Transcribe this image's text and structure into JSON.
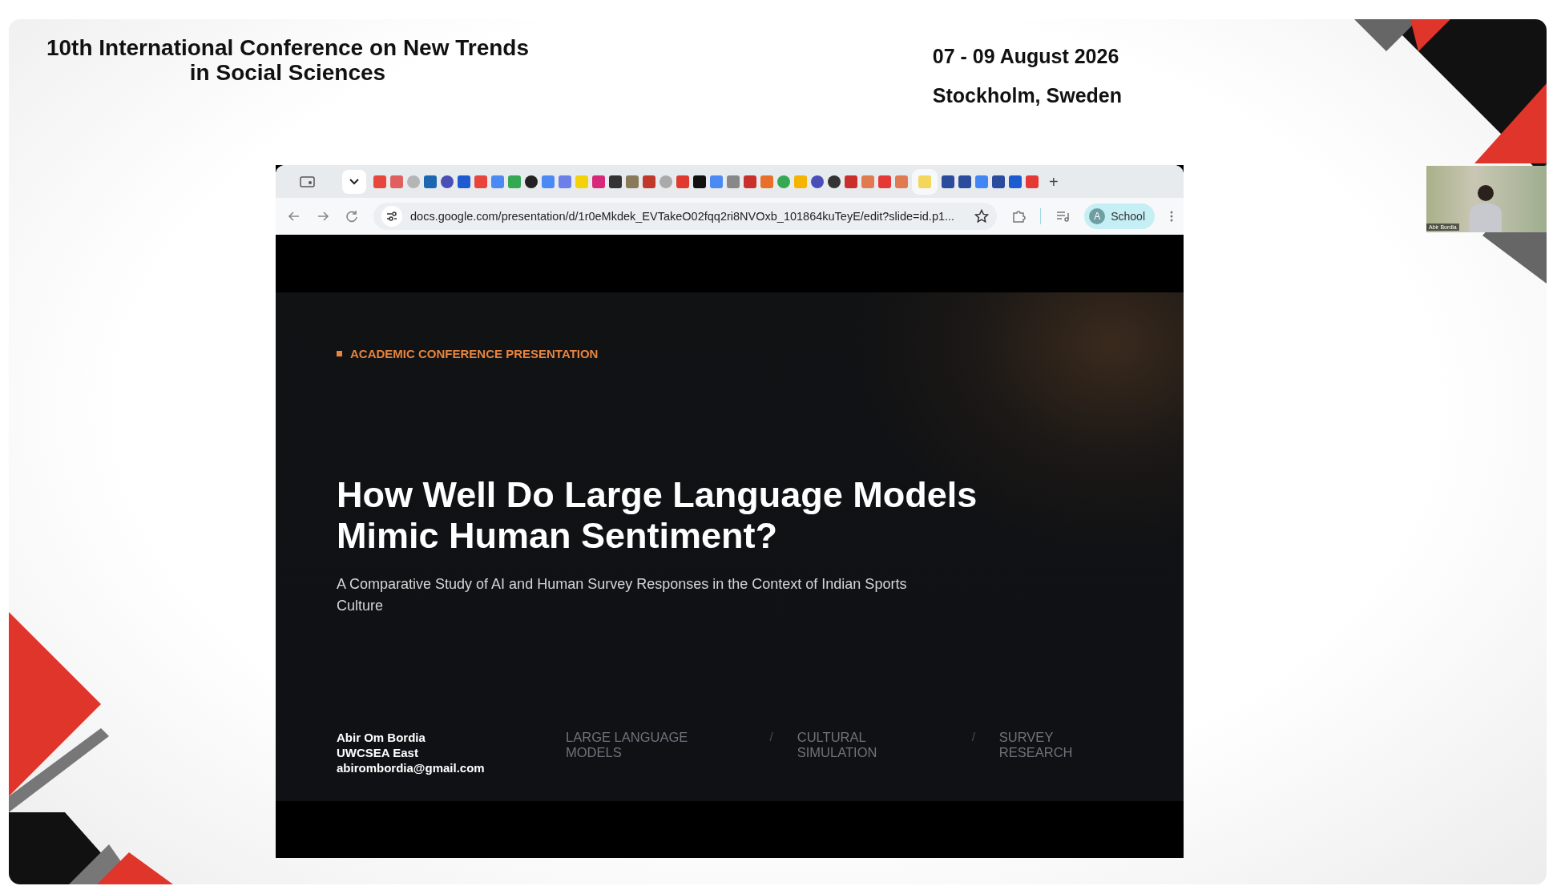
{
  "event": {
    "title_lines": [
      "10th International Conference on New Trends",
      "in Social Sciences"
    ],
    "dates": "07 - 09 August 2026",
    "location": "Stockholm, Sweden"
  },
  "browser": {
    "new_tab": "+",
    "url": "docs.google.com/presentation/d/1r0eMkdek_EVTakeO02fqq2ri8NVOxb_101864kuTeyE/edit?slide=id.p1...",
    "profile": {
      "initial": "A",
      "label": "School"
    }
  },
  "slide": {
    "tag": "ACADEMIC CONFERENCE PRESENTATION",
    "title_lines": [
      "How Well Do Large Language Models",
      "Mimic Human Sentiment?"
    ],
    "subtitle": "A Comparative Study of AI and Human Survey Responses in the Context of Indian Sports Culture",
    "author_lines": [
      "Abir Om Bordia",
      "UWCSEA East",
      "abirombordia@gmail.com"
    ],
    "keywords": [
      {
        "kind": "keyword",
        "text": "LARGE LANGUAGE MODELS"
      },
      {
        "kind": "separator",
        "text": "/"
      },
      {
        "kind": "keyword",
        "text": "CULTURAL SIMULATION"
      },
      {
        "kind": "separator",
        "text": "/"
      },
      {
        "kind": "keyword",
        "text": "SURVEY RESEARCH"
      }
    ]
  },
  "webcam": {
    "name": "Abir Bordia"
  }
}
